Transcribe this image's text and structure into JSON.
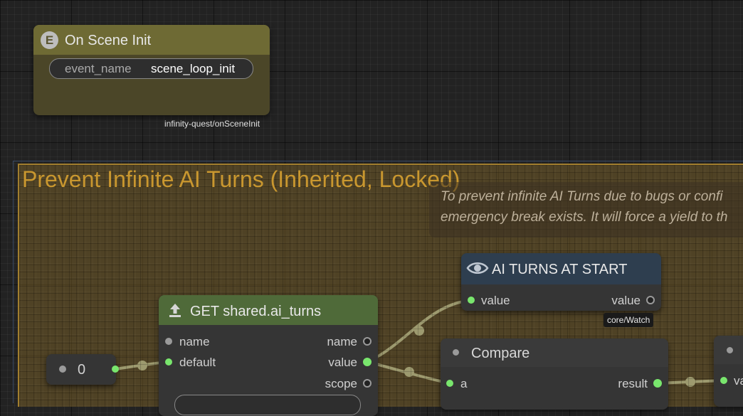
{
  "event_node": {
    "badge": "E",
    "title": "On Scene Init",
    "field_label": "event_name",
    "field_value": "scene_loop_init",
    "type_tag": "infinity-quest/onSceneInit"
  },
  "group": {
    "title": "Prevent Infinite AI Turns (Inherited, Locked)",
    "comment_lines": [
      "To prevent infinite AI Turns due to bugs or confi",
      "emergency break exists. It will force a yield to th"
    ]
  },
  "number_node": {
    "value": "0"
  },
  "get_node": {
    "title": "GET shared.ai_turns",
    "inputs": [
      "name",
      "default"
    ],
    "outputs": [
      "name",
      "value",
      "scope"
    ]
  },
  "watch_node": {
    "title": "AI TURNS AT START",
    "input": "value",
    "output": "value",
    "type_tag": "core/Watch"
  },
  "compare_node": {
    "title": "Compare",
    "input": "a",
    "output": "result"
  },
  "partial_node": {
    "input": "va"
  },
  "colors": {
    "event_header": "#6e6a34",
    "get_header": "#4f6a39",
    "watch_header": "#2e3e4f",
    "wire": "#a8b8a0",
    "connected_slot": "#79e66d"
  }
}
